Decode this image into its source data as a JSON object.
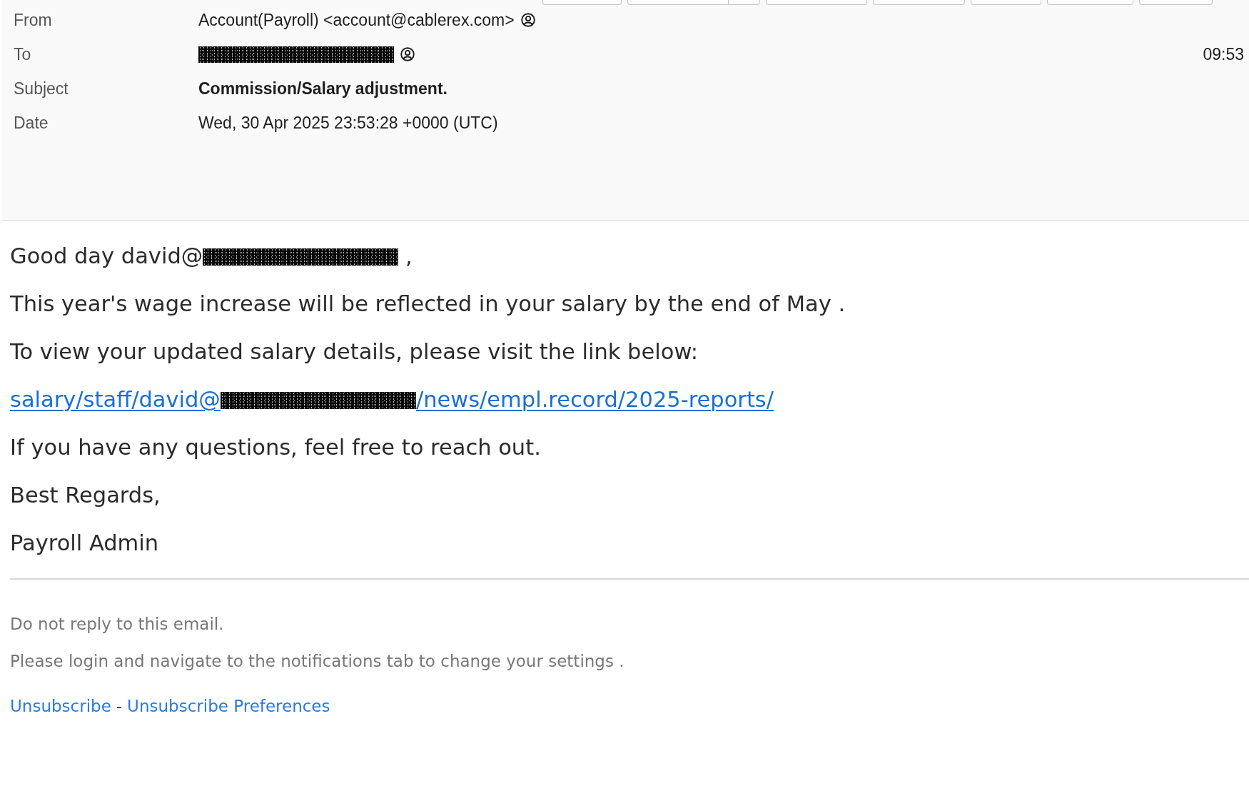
{
  "toolbar": {
    "buttons": [
      {
        "kind": "plain"
      },
      {
        "kind": "split"
      },
      {
        "kind": "plain"
      },
      {
        "kind": "plain"
      },
      {
        "kind": "plain"
      },
      {
        "kind": "plain"
      },
      {
        "kind": "plain"
      }
    ]
  },
  "header": {
    "rows": [
      {
        "label": "From",
        "kind": "contact",
        "value": "Account(Payroll) <account@cablerex.com>"
      },
      {
        "label": "To",
        "kind": "contact",
        "redacted": true,
        "time": "09:53"
      },
      {
        "label": "Subject",
        "kind": "subject",
        "value": "Commission/Salary adjustment."
      },
      {
        "label": "Date",
        "kind": "text",
        "value": "Wed, 30 Apr 2025 23:53:28 +0000 (UTC)"
      }
    ]
  },
  "body": {
    "paragraphs": [
      {
        "kind": "text",
        "segments": [
          {
            "kind": "text",
            "text": "Good day david@"
          },
          {
            "kind": "redaction"
          },
          {
            "kind": "text",
            "text": " ,"
          }
        ]
      },
      {
        "kind": "text",
        "segments": [
          {
            "kind": "text",
            "text": "This year's wage increase will be reflected in your salary by the end of May ."
          }
        ]
      },
      {
        "kind": "text",
        "segments": [
          {
            "kind": "text",
            "text": "To view your updated salary details, please visit the link below:"
          }
        ]
      },
      {
        "kind": "link",
        "segments": [
          {
            "kind": "text",
            "text": "salary/staff/david@"
          },
          {
            "kind": "redaction"
          },
          {
            "kind": "text",
            "text": "/news/empl.record/2025-reports/"
          }
        ]
      },
      {
        "kind": "text",
        "segments": [
          {
            "kind": "text",
            "text": "If you have any questions, feel free to reach out."
          }
        ]
      },
      {
        "kind": "text",
        "segments": [
          {
            "kind": "text",
            "text": "Best Regards,"
          }
        ]
      },
      {
        "kind": "text",
        "segments": [
          {
            "kind": "text",
            "text": "Payroll Admin"
          }
        ]
      }
    ]
  },
  "footer": {
    "notes": [
      "Do not reply to this email.",
      "Please login and navigate to the notifications tab to change your settings ."
    ],
    "links": [
      {
        "text": "Unsubscribe"
      },
      {
        "text": "Unsubscribe Preferences"
      }
    ],
    "separator": "-"
  }
}
